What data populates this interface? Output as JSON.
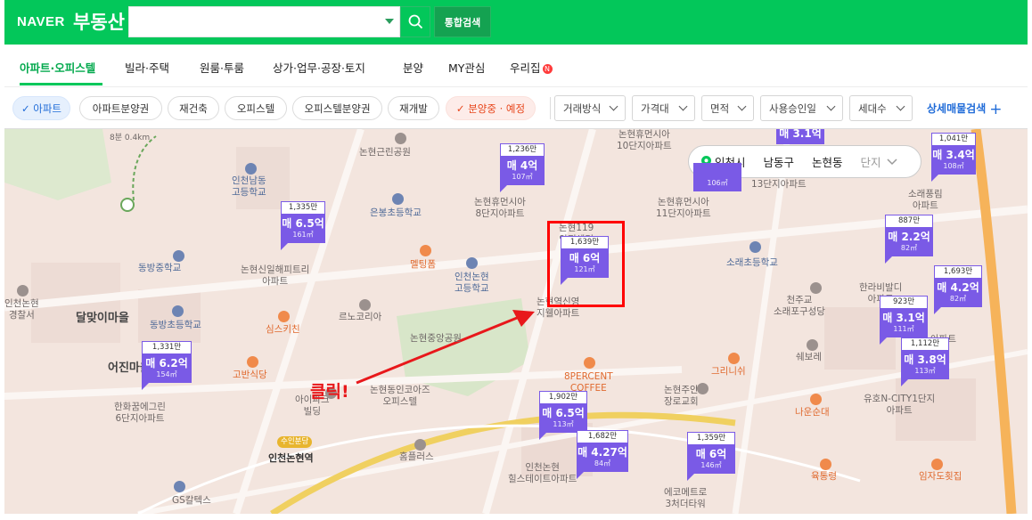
{
  "header": {
    "logo_naver": "NAVER",
    "logo_service": "부동산",
    "search_placeholder": "",
    "search_icon": "search-icon",
    "total_search_label": "통합검색",
    "brand_color": "#03c75a"
  },
  "tabs": [
    {
      "label": "아파트·오피스텔",
      "active": true
    },
    {
      "label": "빌라·주택"
    },
    {
      "label": "원룸·투룸"
    },
    {
      "label": "상가·업무·공장·토지"
    },
    {
      "label": "분양"
    },
    {
      "label": "MY관심"
    },
    {
      "label": "우리집",
      "badge": "N"
    }
  ],
  "filters": {
    "chips": [
      "✓ 아파트",
      "아파트분양권",
      "재건축",
      "오피스텔",
      "오피스텔분양권",
      "재개발",
      "✓ 분양중 · 예정"
    ],
    "dropdowns": [
      "거래방식",
      "가격대",
      "면적",
      "사용승인일",
      "세대수"
    ],
    "detail_search": "상세매물검색",
    "plus": "+"
  },
  "region": {
    "city": "인천시",
    "district": "남동구",
    "dong": "논현동",
    "complex": "단지"
  },
  "markers": [
    {
      "unit": "1,236만",
      "price": "매 4억",
      "area": "107㎡"
    },
    {
      "unit": "1,335만",
      "price": "매 6.5억",
      "area": "161㎡"
    },
    {
      "unit": "1,639만",
      "price": "매 6억",
      "area": "121㎡"
    },
    {
      "unit": "1,331만",
      "price": "매 6.2억",
      "area": "154㎡"
    },
    {
      "unit": "1,902만",
      "price": "매 6.5억",
      "area": "113㎡"
    },
    {
      "unit": "1,682만",
      "price": "매 4.27억",
      "area": "84㎡"
    },
    {
      "unit": "1,359만",
      "price": "매 6억",
      "area": "146㎡"
    },
    {
      "unit": "887만",
      "price": "매 2.2억",
      "area": "82㎡"
    },
    {
      "unit": "1,693만",
      "price": "매 4.2억",
      "area": "82㎡"
    },
    {
      "unit": "923만",
      "price": "매 3.1억",
      "area": "111㎡"
    },
    {
      "unit": "1,112만",
      "price": "매 3.8억",
      "area": "113㎡"
    },
    {
      "unit": "1,041만",
      "price": "매 3.4억",
      "area": "108㎡"
    },
    {
      "unit": "",
      "price": "매 3.1억",
      "area": "106㎡"
    }
  ],
  "labels": {
    "l1": "논현근린공원",
    "l2": "논현휴먼시아\n10단지아파트",
    "l3": "인천남동\n고등학교",
    "l4": "은봉초등학교",
    "l5": "논현휴먼시아\n8단지아파트",
    "l6": "논현휴먼시아\n11단지아파트",
    "l7": "13단지아파트",
    "l8": "소래풍림\n아파트",
    "l9": "논현119\n안전센터",
    "l10": "동방중학교",
    "l11": "논현신일해피트리\n아파트",
    "l12": "멜팅폼",
    "l13": "인천논현\n고등학교",
    "l14": "소래초등학교",
    "l15": "인천논현\n경찰서",
    "l16": "달맞이마을",
    "l17": "동방초등학교",
    "l18": "르노코리아",
    "l19": "논현역신영\n지웰아파트",
    "l20": "천주교\n소래포구성당",
    "l21": "한라비발디\n아파트",
    "l22": "심스키친",
    "l23": "논현중앙공원",
    "l24": "어진마을",
    "l25": "고반식당",
    "l26": "8PERCENT\nCOFFEE",
    "l27": "그리니쉬",
    "l28": "쉐보레",
    "l29": "한화꿈에그린\n6단지아파트",
    "l30": "논현동인코아즈\n오피스텔",
    "l31": "아이파크\n빌딩",
    "l32": "논현주안\n장로교회",
    "l33": "나운순대",
    "l34": "유호N-CITY1단지\n아파트",
    "l35": "인천논현역",
    "l36": "홈플러스",
    "l37": "인천논현\n힐스테이트아파트",
    "l38": "에코메트로\n3처더타워",
    "l39": "육통령",
    "l40": "임자도횟집",
    "l41": "GS칼텍스",
    "l42": "수인분당",
    "l43": "8분 0.4km",
    "l44": "아파트"
  },
  "annotation": "클릭!"
}
